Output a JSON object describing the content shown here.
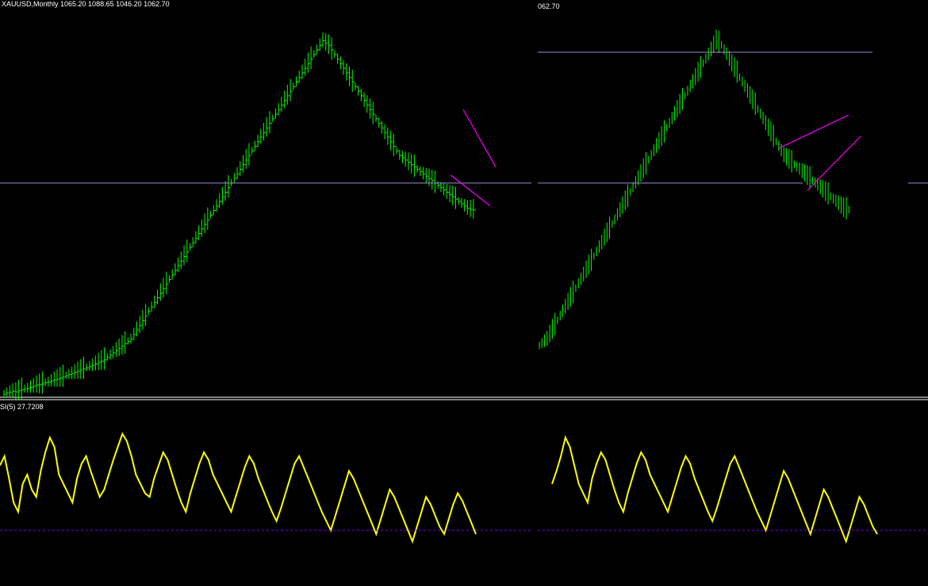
{
  "window": {
    "left_header": "XAUUSD,Monthly  1065.20 1088.65 1046.20 1062.70",
    "right_header": "062.70",
    "rsi_header": "SI(5) 27.7208"
  },
  "colors": {
    "background": "#000000",
    "bars": "#00ff00",
    "trendline": "#ff00ff",
    "level_line": "#9c8cd8",
    "rsi_line": "#ffff00",
    "rsi_level": "#8000ff",
    "separator": "#ffffff"
  },
  "chart_data": [
    {
      "type": "ohlc",
      "panel": "left-price",
      "symbol": "XAUUSD",
      "timeframe": "Monthly",
      "last_bar": {
        "open": 1065.2,
        "high": 1088.65,
        "low": 1046.2,
        "close": 1062.7
      },
      "ylim": [
        250,
        1950
      ],
      "bars": 160,
      "closes": [
        260,
        265,
        268,
        272,
        270,
        275,
        279,
        282,
        285,
        290,
        295,
        300,
        302,
        305,
        310,
        312,
        318,
        322,
        326,
        330,
        335,
        340,
        345,
        350,
        355,
        360,
        365,
        370,
        375,
        380,
        386,
        392,
        398,
        404,
        410,
        420,
        430,
        440,
        450,
        460,
        470,
        480,
        490,
        500,
        520,
        540,
        560,
        580,
        600,
        620,
        640,
        660,
        680,
        700,
        720,
        740,
        760,
        780,
        800,
        820,
        840,
        860,
        880,
        900,
        920,
        940,
        960,
        980,
        1000,
        1020,
        1040,
        1060,
        1080,
        1100,
        1120,
        1140,
        1160,
        1180,
        1200,
        1220,
        1240,
        1260,
        1280,
        1300,
        1320,
        1340,
        1360,
        1380,
        1400,
        1420,
        1440,
        1460,
        1480,
        1500,
        1520,
        1540,
        1560,
        1580,
        1600,
        1620,
        1640,
        1660,
        1680,
        1700,
        1720,
        1740,
        1760,
        1780,
        1800,
        1790,
        1780,
        1760,
        1740,
        1720,
        1700,
        1680,
        1660,
        1640,
        1620,
        1600,
        1580,
        1560,
        1540,
        1520,
        1500,
        1480,
        1460,
        1440,
        1420,
        1400,
        1380,
        1360,
        1340,
        1320,
        1300,
        1290,
        1280,
        1270,
        1260,
        1250,
        1240,
        1230,
        1220,
        1210,
        1200,
        1190,
        1180,
        1170,
        1160,
        1150,
        1140,
        1130,
        1120,
        1110,
        1100,
        1090,
        1080,
        1070,
        1065,
        1062.7
      ],
      "horizontal_level": 1180,
      "channel": {
        "upper": [
          [
            1285,
            1500
          ],
          [
            1375,
            1250
          ]
        ],
        "lower": [
          [
            1250,
            1215
          ],
          [
            1360,
            1080
          ]
        ]
      }
    },
    {
      "type": "ohlc",
      "panel": "right-price",
      "ylim": [
        250,
        1950
      ],
      "bars": 120,
      "horizontal_levels": [
        1180,
        1750
      ],
      "channel": {
        "upper": [
          [
            1260,
            1500
          ],
          [
            1360,
            1650
          ]
        ],
        "lower": [
          [
            1200,
            1350
          ],
          [
            1340,
            1500
          ]
        ]
      }
    },
    {
      "type": "line",
      "panel": "left-rsi",
      "indicator": "RSI",
      "period": 5,
      "last_value": 27.7208,
      "ylim": [
        0,
        100
      ],
      "level": 30,
      "values": [
        65,
        70,
        58,
        45,
        40,
        55,
        60,
        52,
        48,
        62,
        72,
        80,
        75,
        60,
        55,
        50,
        45,
        58,
        66,
        70,
        62,
        55,
        48,
        52,
        60,
        68,
        75,
        82,
        78,
        70,
        60,
        55,
        50,
        48,
        58,
        65,
        72,
        68,
        60,
        52,
        45,
        40,
        50,
        58,
        66,
        72,
        68,
        60,
        55,
        50,
        45,
        40,
        48,
        56,
        64,
        70,
        66,
        58,
        52,
        46,
        40,
        35,
        42,
        50,
        58,
        66,
        70,
        64,
        58,
        52,
        46,
        40,
        35,
        30,
        38,
        46,
        54,
        62,
        58,
        52,
        46,
        40,
        34,
        28,
        36,
        44,
        52,
        48,
        42,
        36,
        30,
        24,
        32,
        40,
        48,
        44,
        38,
        32,
        28,
        36,
        44,
        50,
        46,
        40,
        34,
        28
      ]
    },
    {
      "type": "line",
      "panel": "right-rsi",
      "indicator": "RSI",
      "ylim": [
        0,
        100
      ],
      "level": 30,
      "values": [
        55,
        62,
        70,
        80,
        75,
        65,
        55,
        50,
        45,
        58,
        66,
        72,
        68,
        60,
        52,
        45,
        40,
        50,
        58,
        66,
        72,
        68,
        60,
        55,
        50,
        45,
        40,
        48,
        56,
        64,
        70,
        66,
        58,
        52,
        46,
        40,
        35,
        42,
        50,
        58,
        66,
        70,
        64,
        58,
        52,
        46,
        40,
        35,
        30,
        38,
        46,
        54,
        62,
        58,
        52,
        46,
        40,
        34,
        28,
        36,
        44,
        52,
        48,
        42,
        36,
        30,
        24,
        32,
        40,
        48,
        44,
        38,
        32,
        28
      ]
    }
  ]
}
